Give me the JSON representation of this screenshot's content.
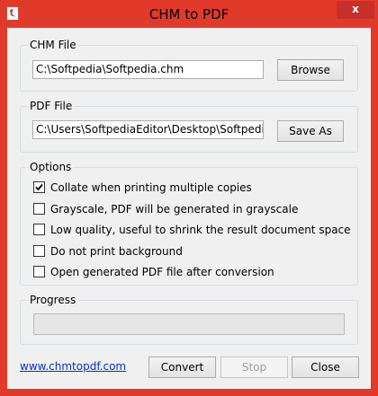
{
  "window": {
    "title": "CHM to PDF",
    "close_glyph": "x",
    "accent_color": "#e23a2a"
  },
  "chm_group": {
    "label": "CHM File",
    "path_value": "C:\\Softpedia\\Softpedia.chm",
    "browse_label": "Browse"
  },
  "pdf_group": {
    "label": "PDF File",
    "path_value": "C:\\Users\\SoftpediaEditor\\Desktop\\Softpedia.pdf",
    "save_as_label": "Save As"
  },
  "options": {
    "label": "Options",
    "items": [
      {
        "label": "Collate when printing multiple copies",
        "checked": true
      },
      {
        "label": "Grayscale, PDF will be generated in grayscale",
        "checked": false
      },
      {
        "label": "Low quality, useful to shrink the result document space",
        "checked": false
      },
      {
        "label": "Do not print background",
        "checked": false
      },
      {
        "label": "Open generated PDF file after conversion",
        "checked": false
      }
    ]
  },
  "progress": {
    "label": "Progress",
    "value_percent": 0
  },
  "footer": {
    "link_text": "www.chmtopdf.com",
    "convert_label": "Convert",
    "stop_label": "Stop",
    "close_label": "Close"
  }
}
